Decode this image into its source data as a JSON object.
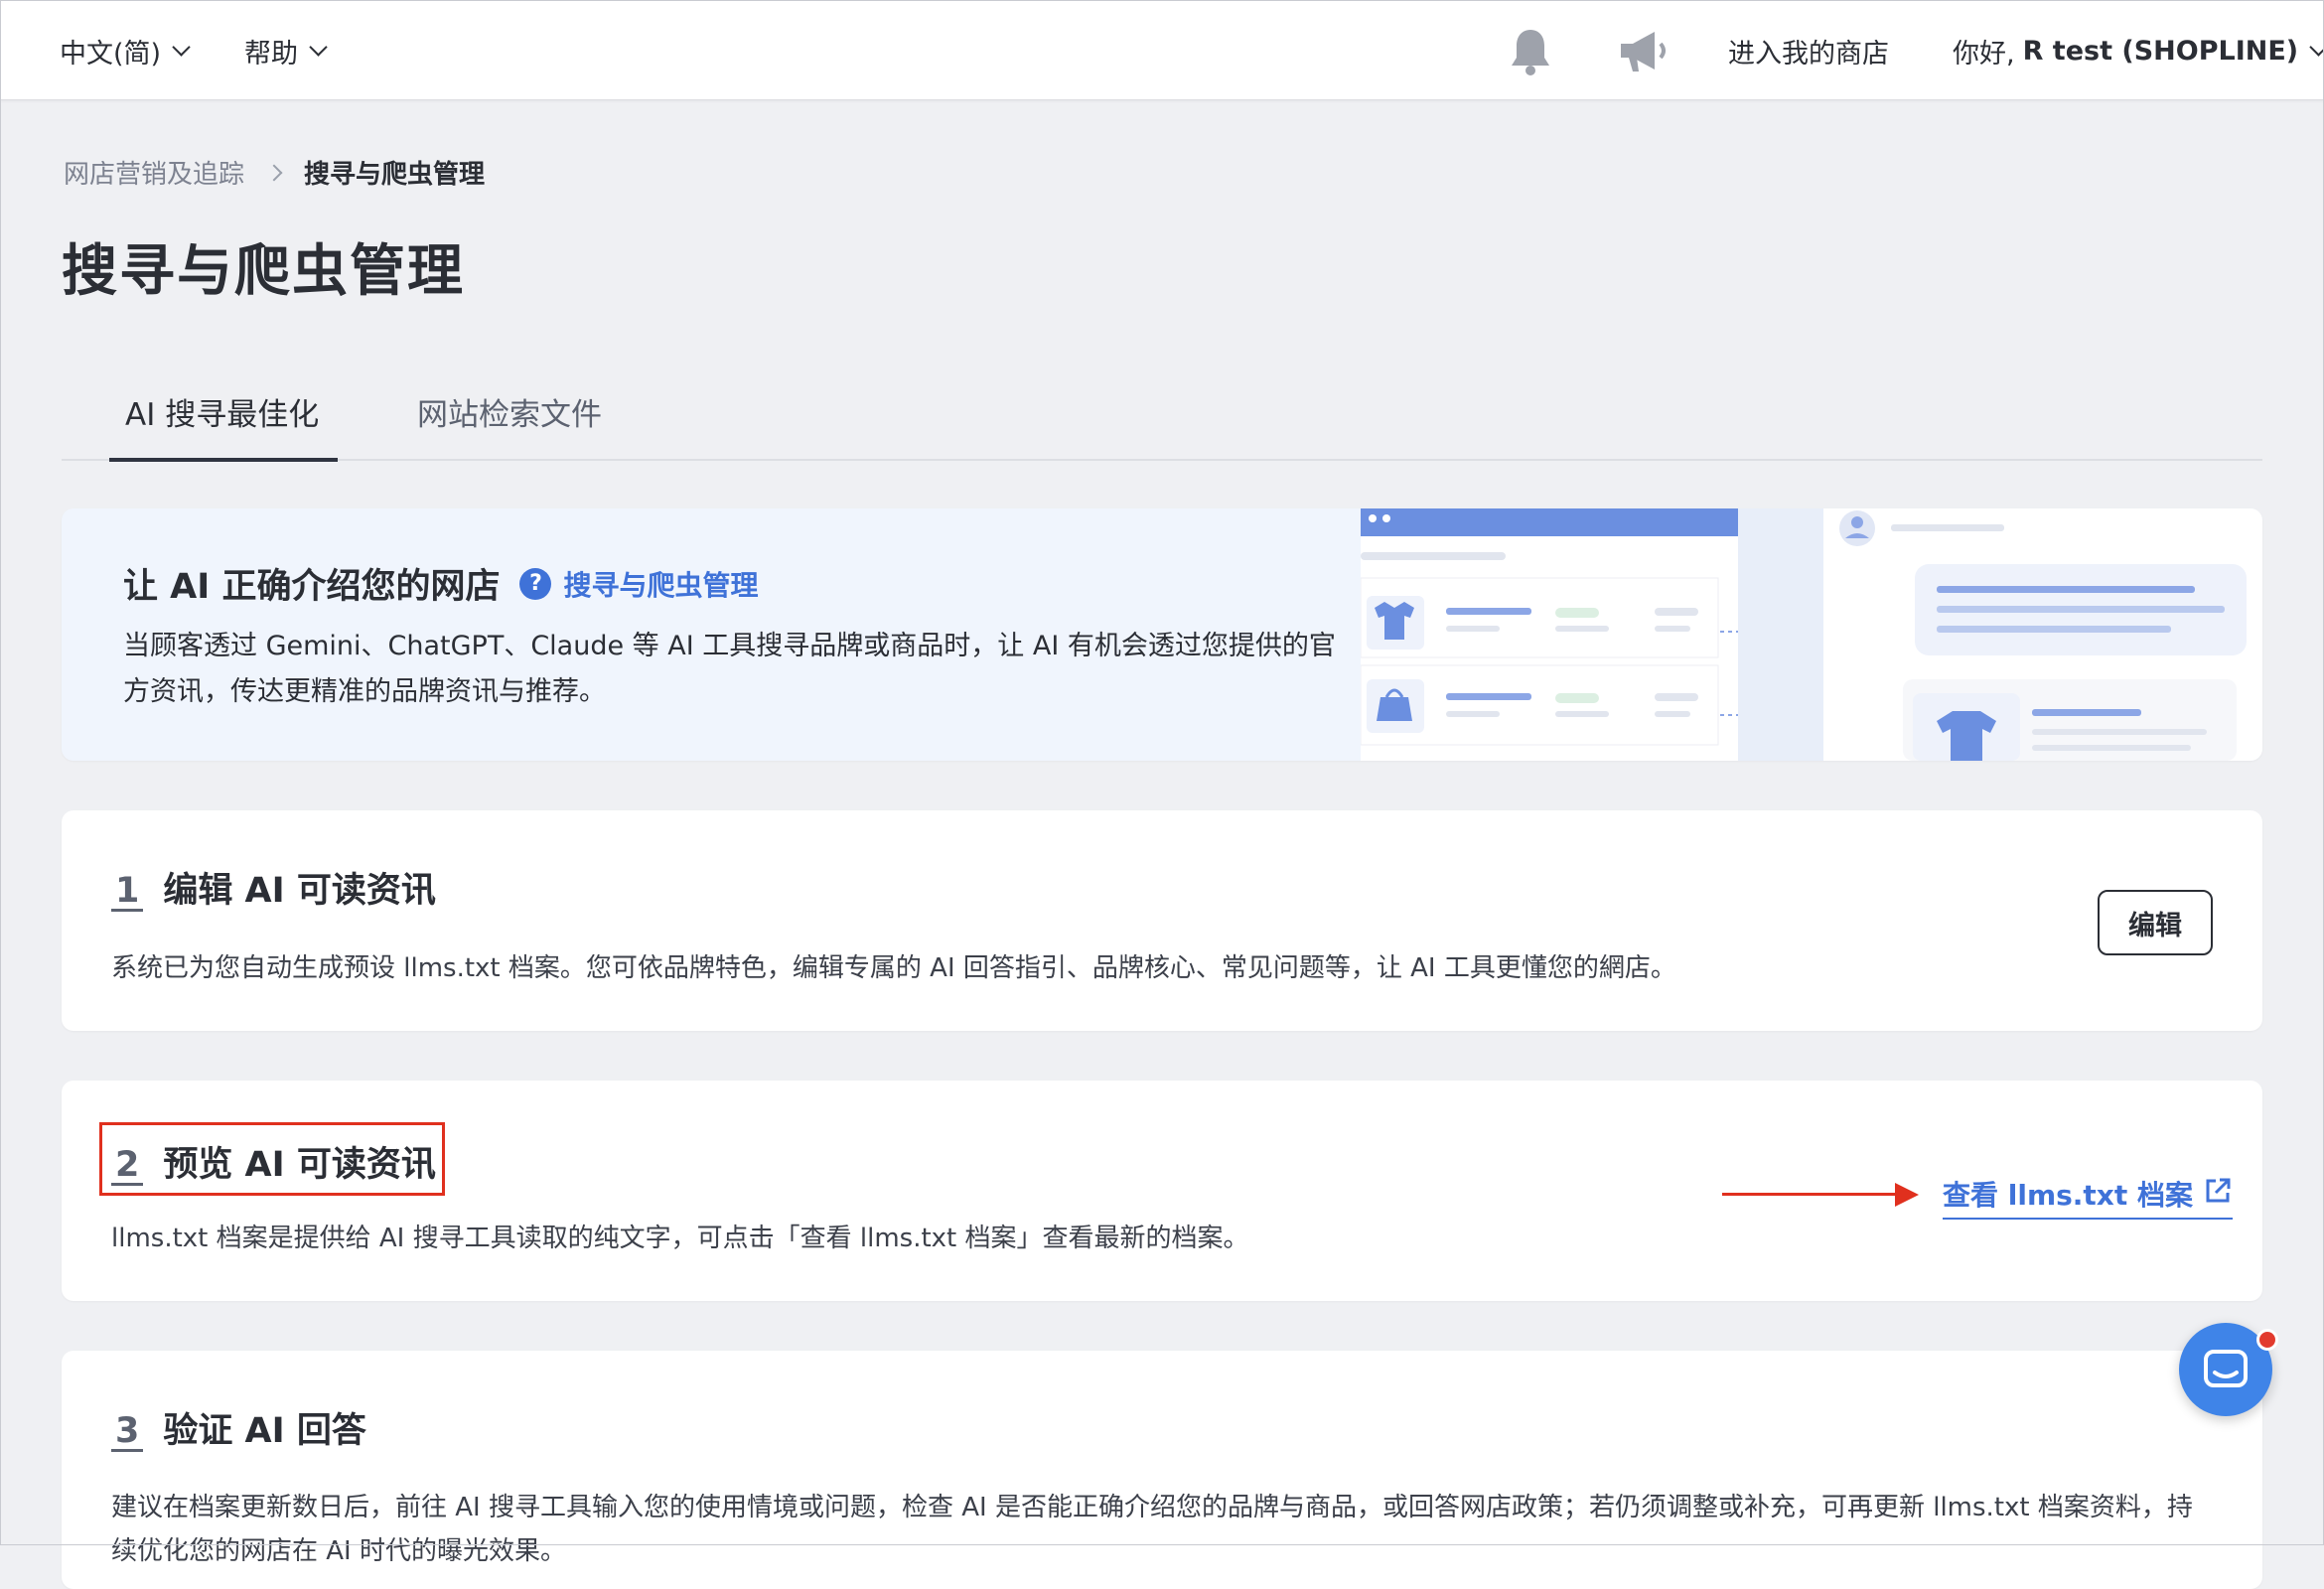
{
  "topbar": {
    "language": "中文(简)",
    "help": "帮助",
    "enter_store": "进入我的商店",
    "greeting_prefix": "你好,",
    "greeting_user": "R test (SHOPLINE)",
    "notification_icon": "bell-icon",
    "announcement_icon": "megaphone-icon"
  },
  "breadcrumb": {
    "parent": "网店营销及追踪",
    "current": "搜寻与爬虫管理"
  },
  "page_title": "搜寻与爬虫管理",
  "tabs": [
    {
      "label": "AI 搜寻最佳化",
      "active": true
    },
    {
      "label": "网站检索文件",
      "active": false
    }
  ],
  "intro": {
    "title": "让 AI 正确介绍您的网店",
    "help_link": "搜寻与爬虫管理",
    "description": "当顾客透过 Gemini、ChatGPT、Claude 等 AI 工具搜寻品牌或商品时，让 AI 有机会透过您提供的官方资讯，传达更精准的品牌资讯与推荐。"
  },
  "steps": [
    {
      "number": "1",
      "title": "编辑 AI 可读资讯",
      "description": "系统已为您自动生成预设 llms.txt 档案。您可依品牌特色，编辑专属的 AI 回答指引、品牌核心、常见问题等，让 AI 工具更懂您的網店。",
      "button": "编辑"
    },
    {
      "number": "2",
      "title": "预览 AI 可读资讯",
      "description": "llms.txt 档案是提供给 AI 搜寻工具读取的纯文字，可点击「查看 llms.txt 档案」查看最新的档案。",
      "link": "查看 llms.txt 档案"
    },
    {
      "number": "3",
      "title": "验证 AI 回答",
      "description": "建议在档案更新数日后，前往 AI 搜寻工具输入您的使用情境或问题，检查 AI 是否能正确介绍您的品牌与商品，或回答网店政策；若仍须调整或补充，可再更新 llms.txt 档案资料，持续优化您的网店在 AI 时代的曝光效果。"
    }
  ],
  "colors": {
    "accent": "#3f72d8",
    "highlight": "#e0301e",
    "chat": "#3f84e8"
  }
}
